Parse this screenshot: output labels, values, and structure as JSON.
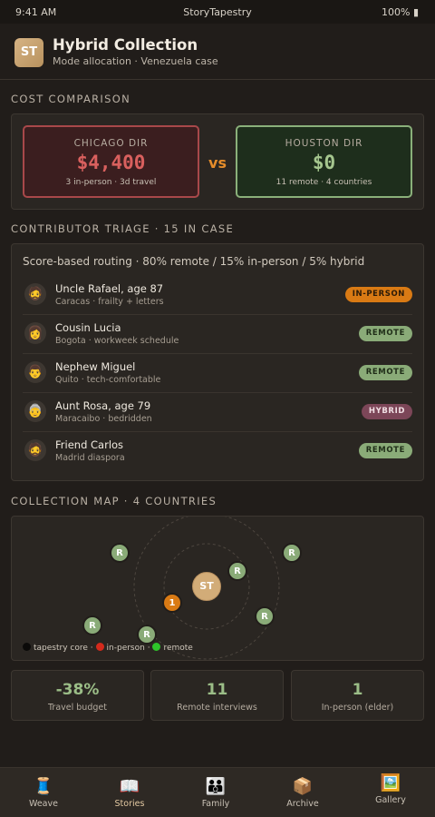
{
  "status_bar": {
    "time": "9:41 AM",
    "app_name": "StoryTapestry",
    "battery": "100% ▮"
  },
  "header": {
    "logo": "ST",
    "title": "Hybrid Collection",
    "subtitle": "Mode allocation · Venezuela case"
  },
  "cost_comparison": {
    "section_label": "COST COMPARISON",
    "left": {
      "city": "CHICAGO DIR",
      "amount": "$4,400",
      "detail": "3 in-person · 3d travel"
    },
    "vs": "vs",
    "right": {
      "city": "HOUSTON DIR",
      "amount": "$0",
      "detail": "11 remote · 4 countries"
    }
  },
  "triage": {
    "section_label": "CONTRIBUTOR TRIAGE · 15 IN CASE",
    "note": "Score-based routing · 80% remote / 15% in-person / 5% hybrid",
    "rows": [
      {
        "avatar": "🧔",
        "name": "Uncle Rafael, age 87",
        "meta": "Caracas · frailty + letters",
        "badge": "IN-PERSON"
      },
      {
        "avatar": "👩",
        "name": "Cousin Lucia",
        "meta": "Bogota · workweek schedule",
        "badge": "REMOTE"
      },
      {
        "avatar": "👨",
        "name": "Nephew Miguel",
        "meta": "Quito · tech-comfortable",
        "badge": "REMOTE"
      },
      {
        "avatar": "👵",
        "name": "Aunt Rosa, age 79",
        "meta": "Maracaibo · bedridden",
        "badge": "HYBRID"
      },
      {
        "avatar": "🧔",
        "name": "Friend Carlos",
        "meta": "Madrid diaspora",
        "badge": "REMOTE"
      }
    ]
  },
  "map": {
    "section_label": "COLLECTION MAP · 4 COUNTRIES",
    "core_label": "ST",
    "remote_label": "R",
    "inperson_label": "1",
    "legend": {
      "core": "tapestry core",
      "sep": "·",
      "inperson": "in-person",
      "remote": "remote"
    }
  },
  "stats": [
    {
      "value": "-38%",
      "label": "Travel budget"
    },
    {
      "value": "11",
      "label": "Remote interviews"
    },
    {
      "value": "1",
      "label": "In-person (elder)"
    }
  ],
  "tabs": [
    {
      "icon": "🧵",
      "label": "Weave"
    },
    {
      "icon": "📖",
      "label": "Stories"
    },
    {
      "icon": "👪",
      "label": "Family"
    },
    {
      "icon": "📦",
      "label": "Archive"
    },
    {
      "icon": "🖼️",
      "label": "Gallery"
    }
  ],
  "colors": {
    "accent": "#d97a14",
    "remote": "#8aab78",
    "hybrid": "#7c4658",
    "danger": "#d9605e"
  }
}
